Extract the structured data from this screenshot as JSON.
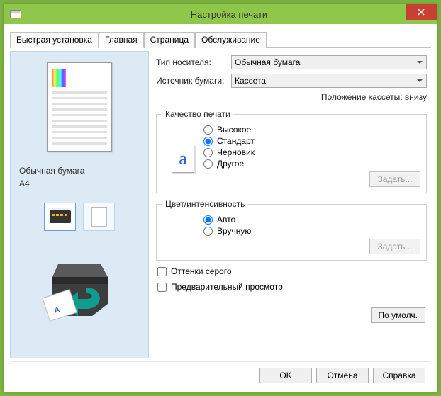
{
  "window": {
    "title": "Настройка печати"
  },
  "tabs": {
    "quick": "Быстрая установка",
    "main": "Главная",
    "page": "Страница",
    "maint": "Обслуживание"
  },
  "left": {
    "media_line1": "Обычная бумага",
    "media_line2": "A4"
  },
  "form": {
    "media_label": "Тип носителя:",
    "media_value": "Обычная бумага",
    "source_label": "Источник бумаги:",
    "source_value": "Кассета",
    "cassette_pos": "Положение кассеты: внизу"
  },
  "quality": {
    "legend": "Качество печати",
    "high": "Высокое",
    "standard": "Стандарт",
    "draft": "Черновик",
    "other": "Другое",
    "set": "Задать..."
  },
  "color": {
    "legend": "Цвет/интенсивность",
    "auto": "Авто",
    "manual": "Вручную",
    "set": "Задать..."
  },
  "checks": {
    "grayscale": "Оттенки серого",
    "preview": "Предварительный просмотр"
  },
  "buttons": {
    "defaults": "По умолч.",
    "ok": "OK",
    "cancel": "Отмена",
    "help": "Справка"
  }
}
